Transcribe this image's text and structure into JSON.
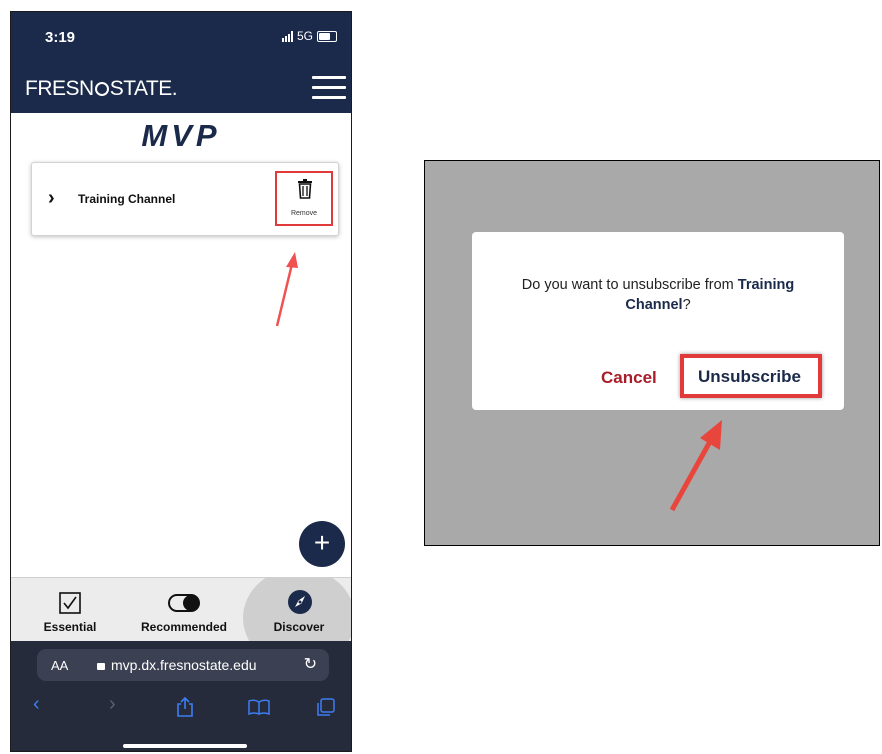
{
  "status_bar": {
    "time": "3:19",
    "network": "5G"
  },
  "header": {
    "logo_left": "FRESN",
    "logo_right": "STATE."
  },
  "page": {
    "title": "MVP"
  },
  "channel": {
    "name": "Training Channel",
    "remove_label": "Remove"
  },
  "fab": {
    "label": "+"
  },
  "tabs": [
    {
      "label": "Essential",
      "icon": "checkbox-icon"
    },
    {
      "label": "Recommended",
      "icon": "toggle-icon"
    },
    {
      "label": "Discover",
      "icon": "compass-icon"
    }
  ],
  "browser": {
    "aa": "AA",
    "url": "mvp.dx.fresnostate.edu"
  },
  "dialog": {
    "message_prefix": "Do you want to unsubscribe from ",
    "channel_bold": "Training Channel",
    "message_suffix": "?",
    "cancel": "Cancel",
    "confirm": "Unsubscribe"
  },
  "colors": {
    "navy": "#1b2a4a",
    "highlight_red": "#e03a3a",
    "cancel_red": "#a71d2a",
    "safari_blue": "#3d7cf2"
  }
}
